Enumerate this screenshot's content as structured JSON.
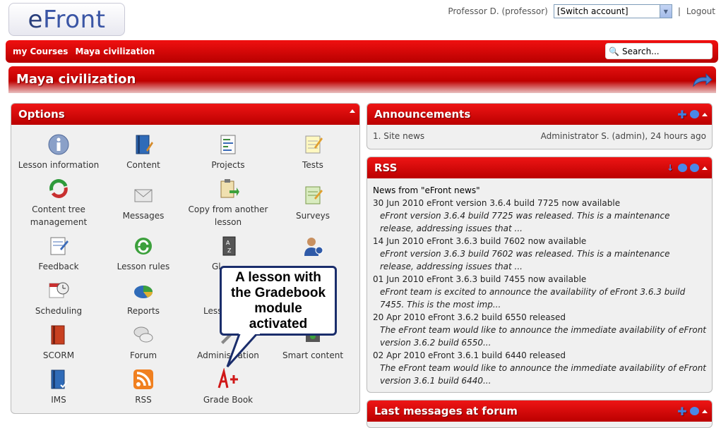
{
  "header": {
    "logo_e": "e",
    "logo_rest": "Front",
    "user_label": "Professor D. (professor)",
    "switch_account": "[Switch account]",
    "logout": "Logout",
    "separator": "|"
  },
  "navbar": {
    "links": [
      "my Courses",
      "Maya civilization"
    ],
    "search_placeholder": "Search..."
  },
  "page_title": "Maya civilization",
  "options": {
    "title": "Options",
    "items": [
      {
        "label": "Lesson information",
        "icon": "info-icon"
      },
      {
        "label": "Content",
        "icon": "book-pencil-icon"
      },
      {
        "label": "Projects",
        "icon": "project-chart-icon"
      },
      {
        "label": "Tests",
        "icon": "test-notepad-icon"
      },
      {
        "label": "Content tree management",
        "icon": "recycle-tree-icon"
      },
      {
        "label": "Messages",
        "icon": "envelope-icon"
      },
      {
        "label": "Copy from another lesson",
        "icon": "clipboard-copy-icon"
      },
      {
        "label": "Surveys",
        "icon": "survey-icon"
      },
      {
        "label": "Feedback",
        "icon": "feedback-icon"
      },
      {
        "label": "Lesson rules",
        "icon": "rules-recycle-icon"
      },
      {
        "label": "Gl",
        "icon": "glossary-icon"
      },
      {
        "label": "",
        "icon": "user-info-icon"
      },
      {
        "label": "Scheduling",
        "icon": "calendar-clock-icon"
      },
      {
        "label": "Reports",
        "icon": "pie-chart-icon"
      },
      {
        "label": "Less",
        "icon": "lesson-icon"
      },
      {
        "label": "",
        "icon": "hidden-icon"
      },
      {
        "label": "SCORM",
        "icon": "scorm-book-icon"
      },
      {
        "label": "Forum",
        "icon": "forum-bubbles-icon"
      },
      {
        "label": "Administration",
        "icon": "admin-wrench-icon"
      },
      {
        "label": "Smart content",
        "icon": "smart-content-icon"
      },
      {
        "label": "IMS",
        "icon": "ims-book-icon"
      },
      {
        "label": "RSS",
        "icon": "rss-icon"
      },
      {
        "label": "Grade Book",
        "icon": "grade-a-plus-icon"
      }
    ]
  },
  "callout": {
    "lines": [
      "A lesson with",
      "the Gradebook",
      "module",
      "activated"
    ]
  },
  "announcements": {
    "title": "Announcements",
    "items": [
      {
        "title": "1. Site news",
        "meta": "Administrator S. (admin), 24 hours ago"
      }
    ]
  },
  "rss": {
    "title": "RSS",
    "source": "News from \"eFront news\"",
    "items": [
      {
        "title": "30 Jun 2010 eFront version 3.6.4 build 7725 now available",
        "desc": "eFront version 3.6.4 build 7725 was released. This is a maintenance release, addressing issues that ..."
      },
      {
        "title": "14 Jun 2010 eFront 3.6.3 build 7602 now available",
        "desc": "eFront version 3.6.3 build 7602 was released. This is a maintenance release, addressing issues that ..."
      },
      {
        "title": "01 Jun 2010 eFront 3.6.3 build 7455 now available",
        "desc": "eFront team is excited to announce the availability of eFront 3.6.3 build 7455. This is the most imp..."
      },
      {
        "title": "20 Apr 2010 eFront 3.6.2 build 6550 released",
        "desc": "The eFront team would like to announce the immediate availability of eFront version 3.6.2 build 6550..."
      },
      {
        "title": "02 Apr 2010 eFront 3.6.1 build 6440 released",
        "desc": "The eFront team would like to announce the immediate availability of eFront version 3.6.1 build 6440..."
      }
    ]
  },
  "forum": {
    "title": "Last messages at forum"
  },
  "colors": {
    "accent_red": "#d00000",
    "callout_border": "#1a2d6b"
  }
}
